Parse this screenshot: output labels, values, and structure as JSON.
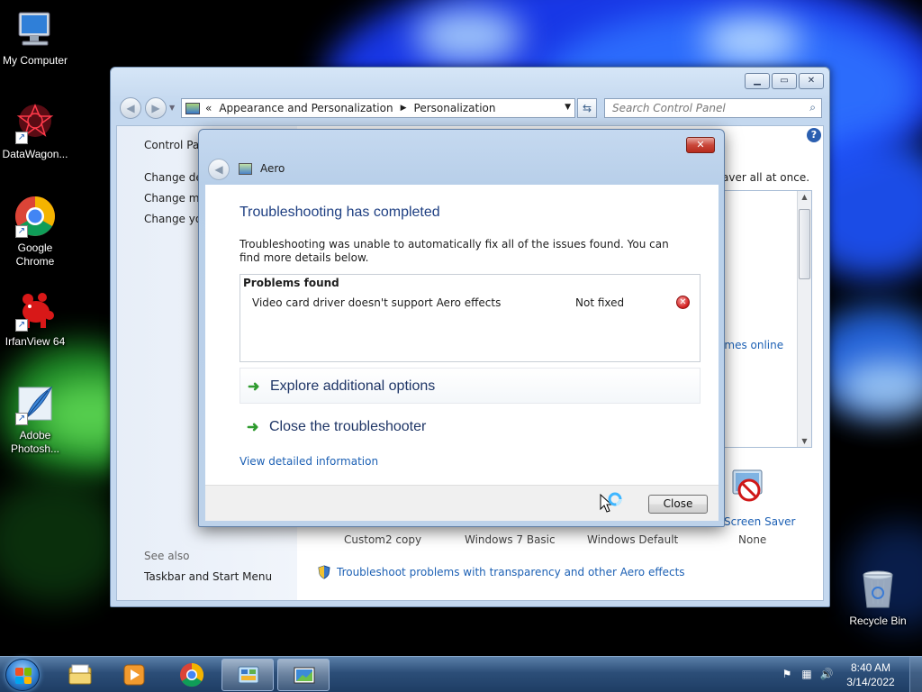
{
  "desktop": {
    "icons": [
      {
        "label": "My Computer"
      },
      {
        "label": "DataWagon..."
      },
      {
        "label": "Google Chrome"
      },
      {
        "label": "IrfanView 64"
      },
      {
        "label": "Adobe Photosh..."
      },
      {
        "label": "Recycle Bin"
      }
    ]
  },
  "control_panel": {
    "breadcrumb": {
      "back_glyph": "«",
      "level1": "Appearance and Personalization",
      "separator": "▶",
      "level2": "Personalization"
    },
    "search_placeholder": "Search Control Panel",
    "left_links": {
      "home": "Control Panel Home",
      "desktop_icons": "Change desktop icons",
      "mouse_pointers": "Change mouse pointers",
      "account_picture": "Change your account picture"
    },
    "see_also_heading": "See also",
    "see_also_link": "Taskbar and Start Menu",
    "visible_fragments": {
      "intro_tail": "aver all at once.",
      "themes_online": "emes online"
    },
    "bottom_items": {
      "screen_saver": "Screen Saver",
      "screen_saver_value": "None",
      "custom2": "Custom2 copy",
      "win7basic": "Windows 7 Basic",
      "windefault": "Windows Default"
    },
    "troubleshoot_link": "Troubleshoot problems with transparency and other Aero effects"
  },
  "dialog": {
    "title": "Aero",
    "heading": "Troubleshooting has completed",
    "description": "Troubleshooting was unable to automatically fix all of the issues found. You can find more details below.",
    "problems_header": "Problems found",
    "problems": [
      {
        "name": "Video card driver doesn't support Aero effects",
        "status": "Not fixed"
      }
    ],
    "commands": {
      "explore": "Explore additional options",
      "close_troubleshooter": "Close the troubleshooter"
    },
    "detail_link": "View detailed information",
    "close_button": "Close"
  },
  "taskbar": {
    "clock_time": "8:40 AM",
    "clock_date": "3/14/2022"
  },
  "colors": {
    "link_blue": "#1c60b4",
    "heading_blue": "#1e3f82",
    "error_red": "#d11c1c",
    "arrow_green": "#2f9b2f"
  }
}
